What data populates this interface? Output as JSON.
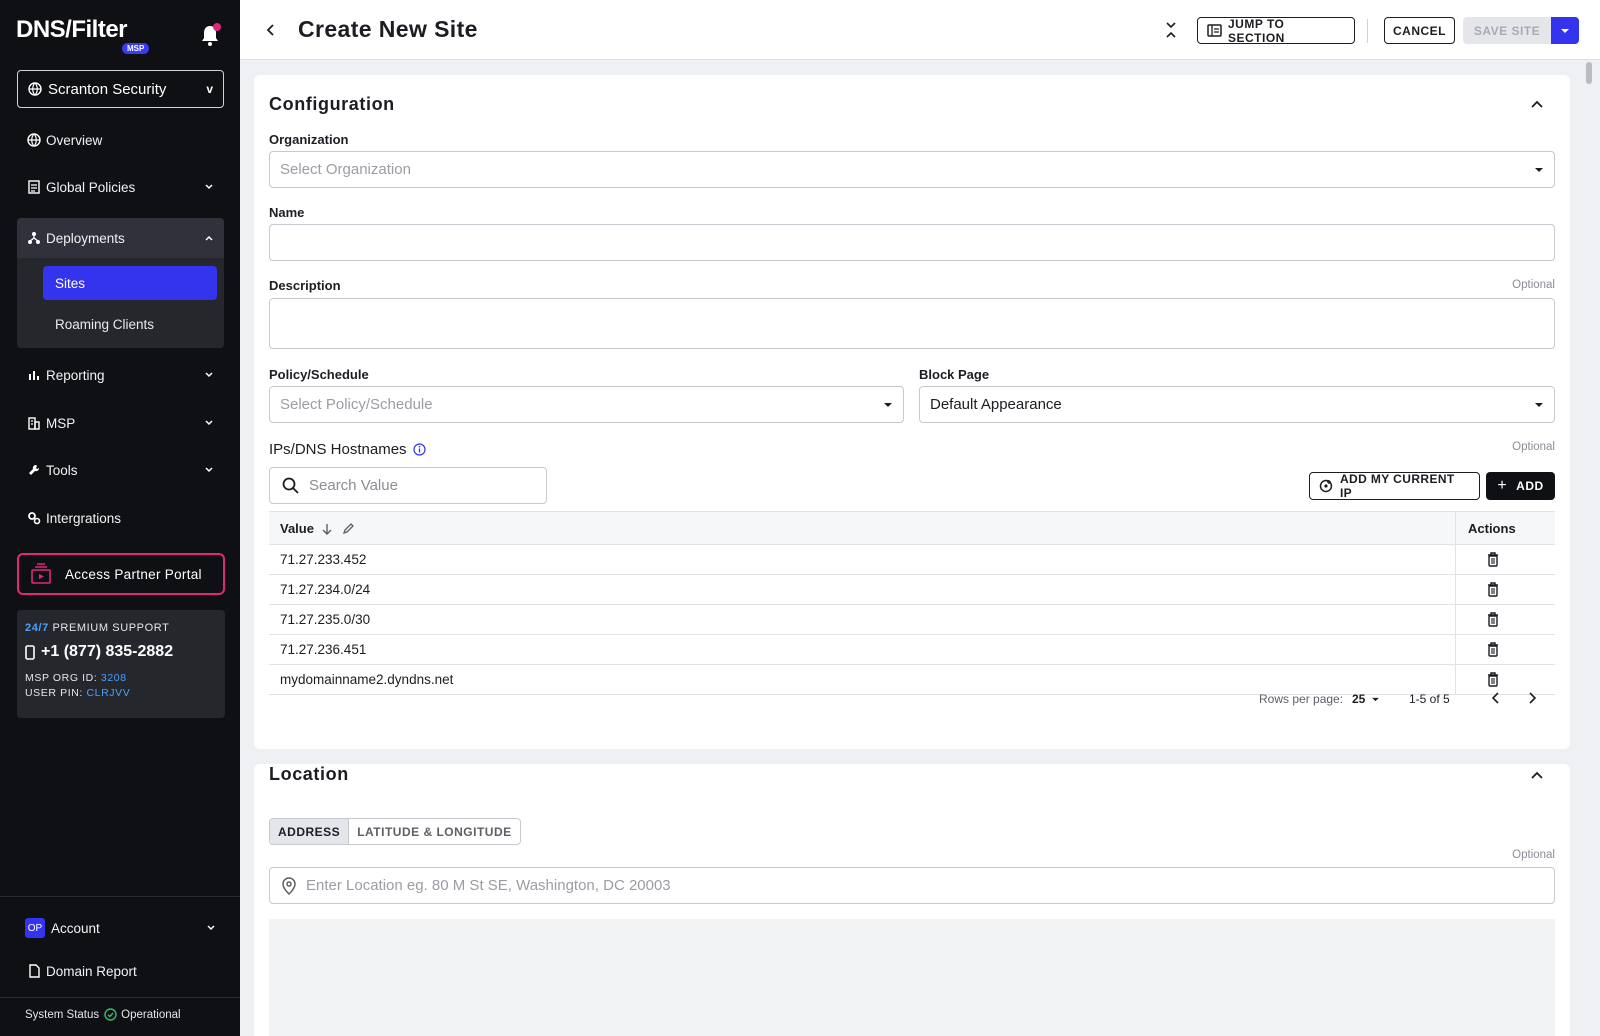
{
  "sidebar": {
    "logo_text": "DNS/Filter",
    "logo_badge": "MSP",
    "org_selector": "Scranton Security",
    "org_caret": "v",
    "nav": {
      "overview": "Overview",
      "global_policies": "Global Policies",
      "deployments": "Deployments",
      "sites": "Sites",
      "roaming_clients": "Roaming Clients",
      "reporting": "Reporting",
      "msp": "MSP",
      "tools": "Tools",
      "integrations": "Intergrations"
    },
    "partner_portal": "Access Partner Portal",
    "support": {
      "hours": "24/7",
      "label": "PREMIUM SUPPORT",
      "phone": "+1 (877) 835-2882",
      "org_id_label": "MSP ORG ID:",
      "org_id": "3208",
      "pin_label": "USER PIN:",
      "pin": "CLRJVV"
    },
    "account": {
      "initials": "OP",
      "label": "Account"
    },
    "domain_report": "Domain Report",
    "system_status": {
      "label": "System Status",
      "value": "Operational"
    }
  },
  "header": {
    "title": "Create New Site",
    "jump_to_section": "JUMP TO SECTION",
    "cancel": "CANCEL",
    "save_site": "SAVE SITE"
  },
  "configuration": {
    "title": "Configuration",
    "organization": {
      "label": "Organization",
      "placeholder": "Select Organization"
    },
    "name": {
      "label": "Name",
      "value": ""
    },
    "description": {
      "label": "Description",
      "optional": "Optional",
      "value": ""
    },
    "policy": {
      "label": "Policy/Schedule",
      "placeholder": "Select Policy/Schedule"
    },
    "block_page": {
      "label": "Block Page",
      "value": "Default Appearance"
    },
    "ips": {
      "label": "IPs/DNS Hostnames",
      "optional": "Optional",
      "search_placeholder": "Search Value",
      "add_current_ip": "ADD MY CURRENT IP",
      "add": "ADD",
      "columns": {
        "value": "Value",
        "actions": "Actions"
      },
      "rows": [
        "71.27.233.452",
        "71.27.234.0/24",
        "71.27.235.0/30",
        "71.27.236.451",
        "mydomainname2.dyndns.net"
      ],
      "pagination": {
        "rows_per_page_label": "Rows per page:",
        "rows_per_page": "25",
        "range": "1-5 of 5"
      }
    }
  },
  "location": {
    "title": "Location",
    "tabs": [
      "ADDRESS",
      "LATITUDE & LONGITUDE"
    ],
    "optional": "Optional",
    "placeholder": "Enter Location eg. 80 M St SE, Washington, DC 20003"
  },
  "colors": {
    "accent": "#3434ee",
    "partner_border": "#e0287a",
    "sidebar_bg": "#0f1014"
  }
}
